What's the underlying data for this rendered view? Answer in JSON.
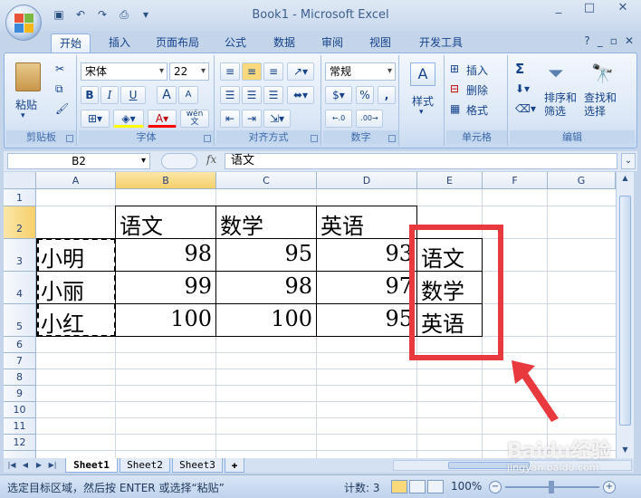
{
  "window": {
    "title": "Book1 - Microsoft Excel",
    "controls": [
      "_",
      "□",
      "✕"
    ]
  },
  "qat": {
    "items": [
      "save",
      "undo",
      "redo",
      "print-preview",
      "customize"
    ]
  },
  "tabs": [
    "开始",
    "插入",
    "页面布局",
    "公式",
    "数据",
    "审阅",
    "视图",
    "开发工具"
  ],
  "tab_help": {
    "help": "?",
    "minimize": "_",
    "restore": "▫",
    "close": "✕"
  },
  "ribbon": {
    "clipboard": {
      "label": "剪贴板",
      "paste": "粘贴"
    },
    "font": {
      "label": "字体",
      "name": "宋体",
      "size": "22",
      "bold": "B",
      "italic": "I",
      "underline": "U",
      "grow": "A",
      "shrink": "A",
      "wen": "wén\n文"
    },
    "alignment": {
      "label": "对齐方式"
    },
    "number": {
      "label": "数字",
      "format": "常规",
      "percent": "%",
      "comma": ","
    },
    "styles": {
      "label": "样式"
    },
    "cells": {
      "label": "单元格",
      "insert": "插入",
      "delete": "删除",
      "format": "格式"
    },
    "editing": {
      "label": "编辑",
      "sort": "排序和\n筛选",
      "find": "查找和\n选择",
      "sigma": "Σ"
    }
  },
  "formula_bar": {
    "name_box": "B2",
    "fx": "fx",
    "formula": "语文"
  },
  "columns": [
    "A",
    "B",
    "C",
    "D",
    "E",
    "F",
    "G"
  ],
  "rows": [
    "1",
    "2",
    "3",
    "4",
    "5",
    "6",
    "7",
    "8",
    "9",
    "10",
    "11",
    "12"
  ],
  "cells": {
    "B2": "语文",
    "C2": "数学",
    "D2": "英语",
    "A3": "小明",
    "B3": "98",
    "C3": "95",
    "D3": "93",
    "A4": "小丽",
    "B4": "99",
    "C4": "98",
    "D4": "97",
    "A5": "小红",
    "B5": "100",
    "C5": "100",
    "D5": "95",
    "E3": "语文",
    "E4": "数学",
    "E5": "英语"
  },
  "sheets": [
    "Sheet1",
    "Sheet2",
    "Sheet3"
  ],
  "status": {
    "message": "选定目标区域，然后按 ENTER 或选择“粘贴”",
    "count": "计数: 3",
    "zoom": "100%"
  },
  "watermark": {
    "text": "Baidu经验",
    "sub": "jingyan.baidu.com"
  },
  "colors": {
    "annotation_red": "#e8393f",
    "accent": "#15428b"
  }
}
